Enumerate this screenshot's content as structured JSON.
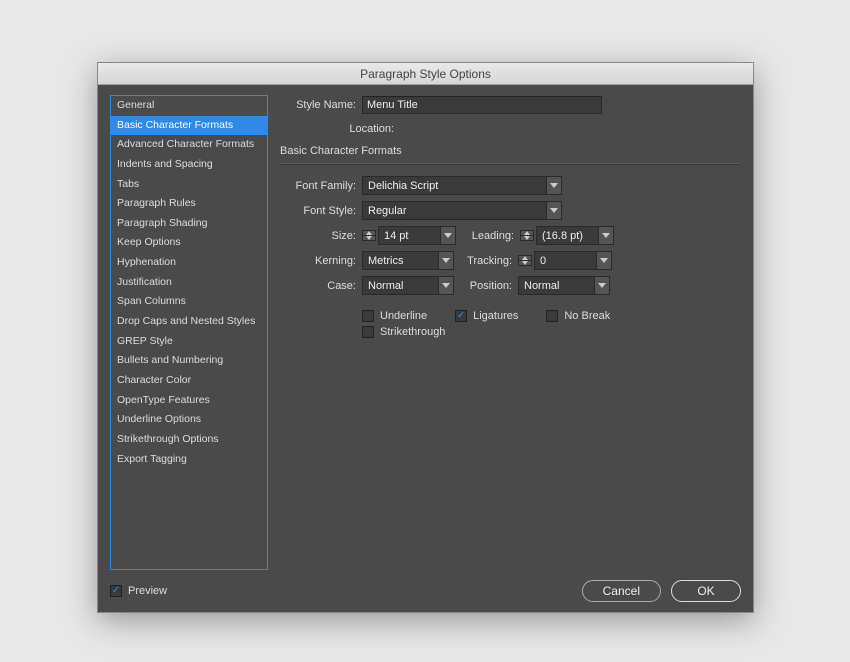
{
  "window": {
    "title": "Paragraph Style Options"
  },
  "sidebar": {
    "selectedIndex": 1,
    "items": [
      "General",
      "Basic Character Formats",
      "Advanced Character Formats",
      "Indents and Spacing",
      "Tabs",
      "Paragraph Rules",
      "Paragraph Shading",
      "Keep Options",
      "Hyphenation",
      "Justification",
      "Span Columns",
      "Drop Caps and Nested Styles",
      "GREP Style",
      "Bullets and Numbering",
      "Character Color",
      "OpenType Features",
      "Underline Options",
      "Strikethrough Options",
      "Export Tagging"
    ]
  },
  "header": {
    "styleNameLabel": "Style Name:",
    "styleNameValue": "Menu Title",
    "locationLabel": "Location:",
    "sectionTitle": "Basic Character Formats"
  },
  "form": {
    "fontFamily": {
      "label": "Font Family:",
      "value": "Delichia Script"
    },
    "fontStyle": {
      "label": "Font Style:",
      "value": "Regular"
    },
    "size": {
      "label": "Size:",
      "value": "14 pt"
    },
    "leading": {
      "label": "Leading:",
      "value": "(16.8 pt)"
    },
    "kerning": {
      "label": "Kerning:",
      "value": "Metrics"
    },
    "tracking": {
      "label": "Tracking:",
      "value": "0"
    },
    "case": {
      "label": "Case:",
      "value": "Normal"
    },
    "position": {
      "label": "Position:",
      "value": "Normal"
    },
    "underline": {
      "label": "Underline",
      "checked": false
    },
    "ligatures": {
      "label": "Ligatures",
      "checked": true
    },
    "noBreak": {
      "label": "No Break",
      "checked": false
    },
    "strikethrough": {
      "label": "Strikethrough",
      "checked": false
    }
  },
  "footer": {
    "preview": {
      "label": "Preview",
      "checked": true
    },
    "cancel": "Cancel",
    "ok": "OK"
  }
}
